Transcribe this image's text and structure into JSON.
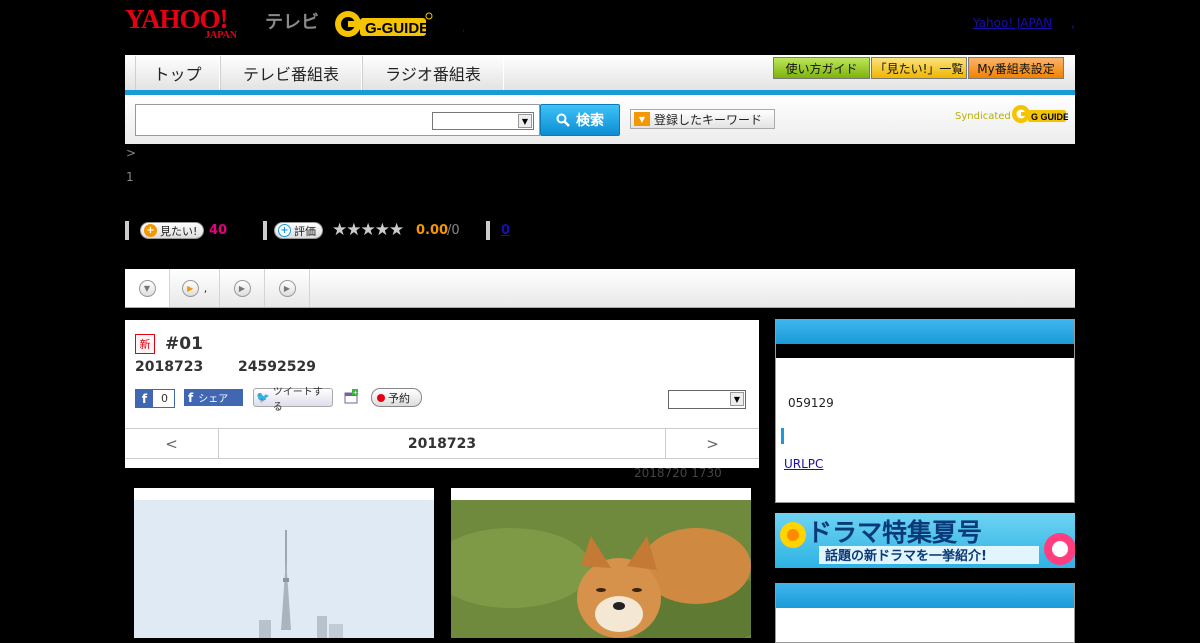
{
  "header": {
    "yahoo_logo": "YAHOO!",
    "yahoo_logo_sub": "JAPAN",
    "tv_label": "テレビ",
    "gguide_logo": "G-GUIDE",
    "dot": ",",
    "yahoo_link": "Yahoo! JAPAN",
    "yahoo_link_sep": ","
  },
  "nav": {
    "tabs": [
      {
        "label": "トップ"
      },
      {
        "label": "テレビ番組表"
      },
      {
        "label": "ラジオ番組表"
      }
    ],
    "guide_button": "使い方ガイド",
    "mitai_list_button": "「見たい!」一覧",
    "my_schedule_button": "My番組表設定"
  },
  "search": {
    "input_value": "",
    "select_value": "",
    "search_button": "検索",
    "keyword_button": "登録したキーワード",
    "syndicated": "Syndicated",
    "syndicated_logo": "G GUIDE"
  },
  "breadcrumb": ">",
  "page_number": "1",
  "stats": {
    "mitai_label": "見たい!",
    "mitai_count": "40",
    "rating_label": "評価",
    "stars": "★★★★★",
    "score": "0.00",
    "score_den": "/0",
    "comment_count": "0"
  },
  "subtabs": {
    "tab2_label": ","
  },
  "program": {
    "new_badge": "新",
    "title": "#01",
    "date": "2018723",
    "time": "24592529",
    "fb_like_count": "0",
    "fb_share": "シェア",
    "tweet": "ツイートする",
    "record": "予約",
    "select_value": "",
    "prev": "<",
    "day_label": "2018723",
    "next": ">"
  },
  "updated": "2018720  1730",
  "side": {
    "number": "059129",
    "link": "URLPC    "
  },
  "banner": {
    "title": "ドラマ特集夏号",
    "subtitle": "話題の新ドラマを一挙紹介!"
  },
  "colors": {
    "accent_blue": "#1a9bd8",
    "yahoo_red": "#e60012",
    "orange": "#f39800",
    "pink": "#e4007f"
  }
}
